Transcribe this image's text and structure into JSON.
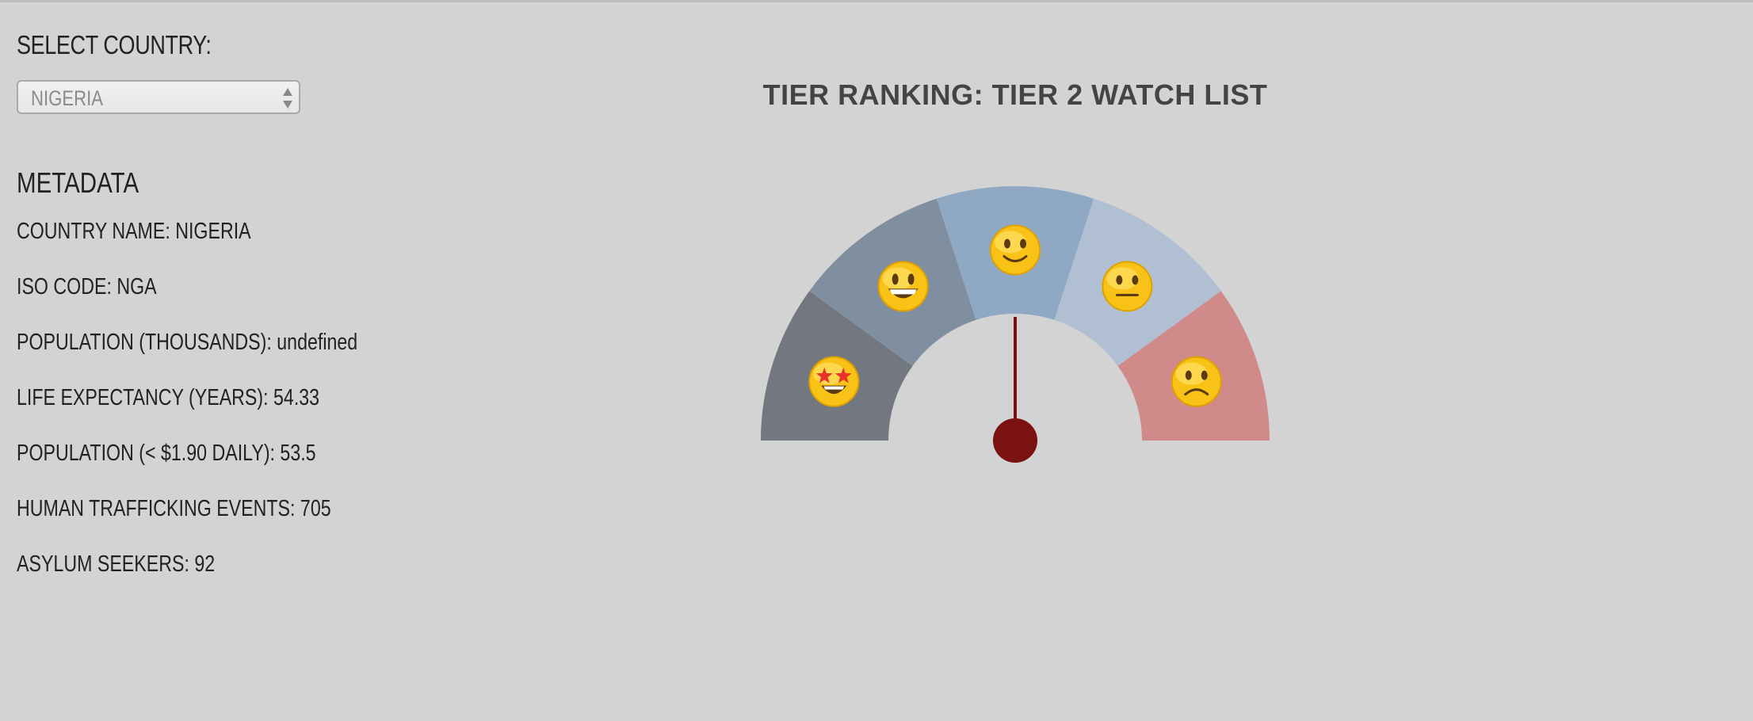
{
  "select": {
    "label": "SELECT COUNTRY:",
    "value": "NIGERIA"
  },
  "metadata": {
    "title": "METADATA",
    "rows": [
      "COUNTRY NAME: NIGERIA",
      "ISO CODE: NGA",
      "POPULATION (THOUSANDS): undefined",
      "LIFE EXPECTANCY (YEARS): 54.33",
      "POPULATION (< $1.90 DAILY): 53.5",
      "HUMAN TRAFFICKING EVENTS: 705",
      "ASYLUM SEEKERS: 92"
    ]
  },
  "gauge": {
    "title": "TIER RANKING: TIER 2 WATCH LIST",
    "segments": [
      {
        "icon": "star-struck-face-icon",
        "color": "#727780"
      },
      {
        "icon": "grinning-face-icon",
        "color": "#808f9f"
      },
      {
        "icon": "slightly-smiling-face-icon",
        "color": "#8fa8c3"
      },
      {
        "icon": "neutral-face-icon",
        "color": "#b0c0d2"
      },
      {
        "icon": "slightly-frowning-face-icon",
        "color": "#d08a8a"
      }
    ],
    "needle_segment_index": 2,
    "needle_color": "#7a1212"
  }
}
